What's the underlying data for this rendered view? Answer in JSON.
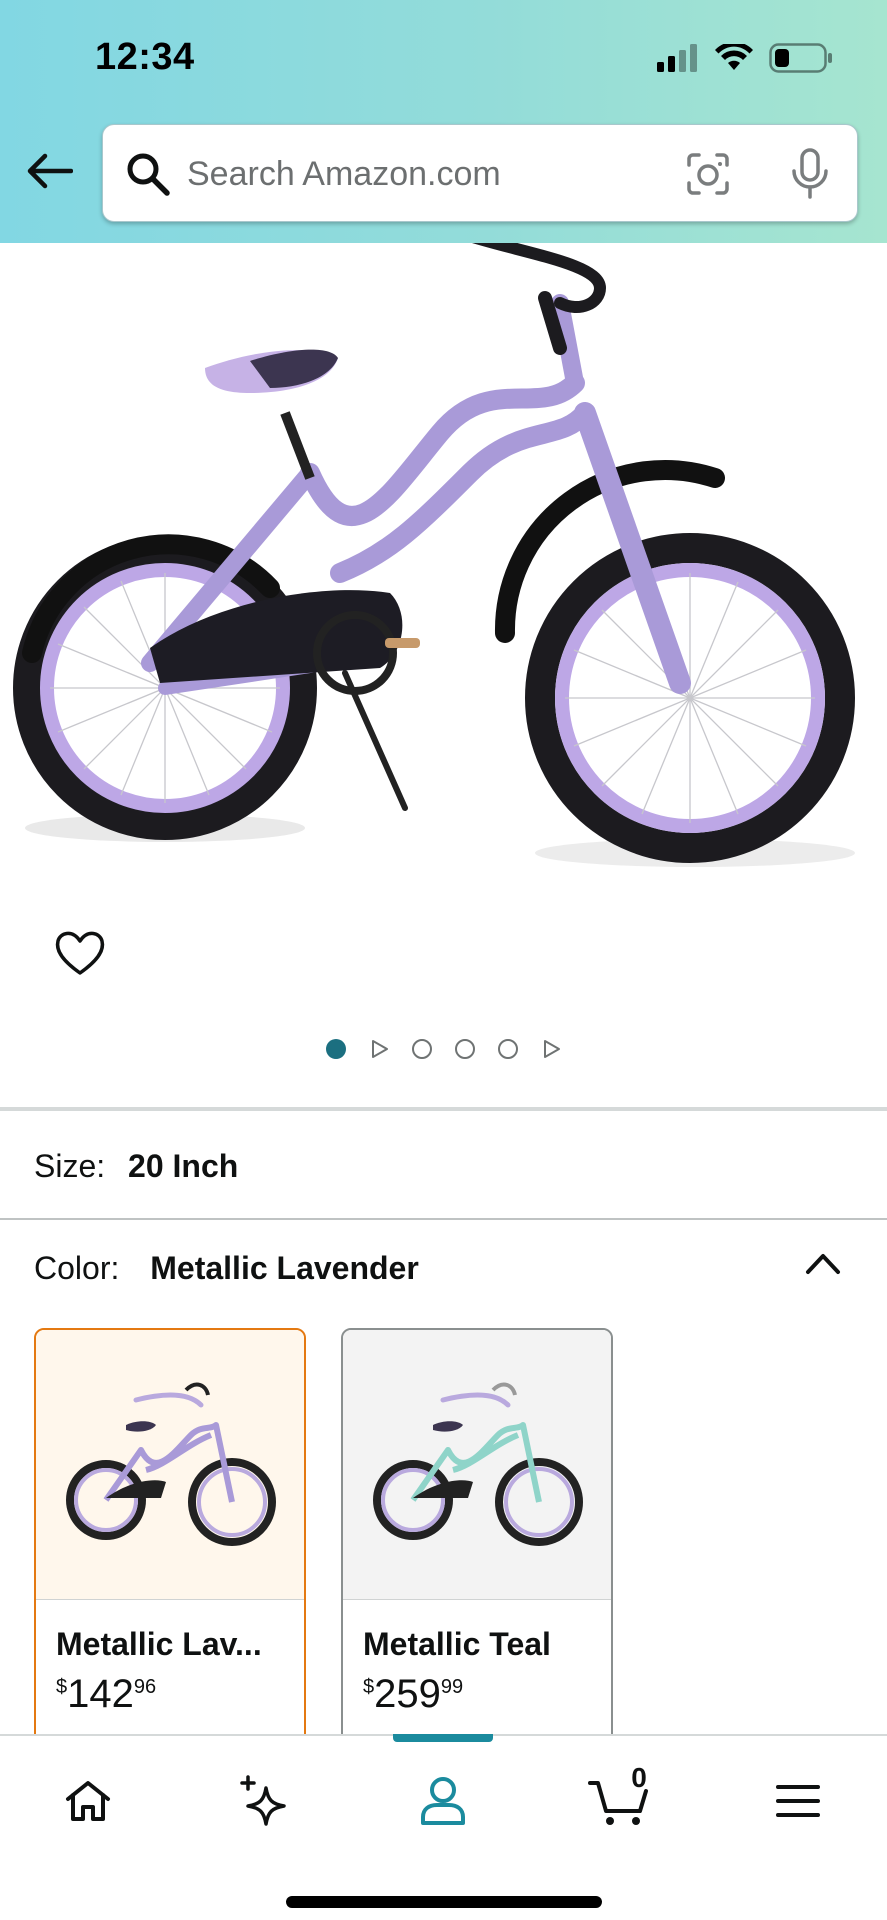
{
  "status_bar": {
    "time": "12:34",
    "icons": [
      "signal-icon",
      "wifi-icon",
      "battery-icon"
    ]
  },
  "search": {
    "placeholder": "Search Amazon.com"
  },
  "product": {
    "image_description": "hero bike image",
    "carousel": {
      "active_index": 0,
      "items": [
        "image",
        "video",
        "image",
        "image",
        "image",
        "video"
      ]
    }
  },
  "size": {
    "label": "Size:",
    "value": "20 Inch"
  },
  "color": {
    "label": "Color:",
    "value": "Metallic Lavender",
    "options": [
      {
        "name": "Metallic Lav...",
        "price_symbol": "$",
        "price_whole": "142",
        "price_fraction": "96",
        "selected": true
      },
      {
        "name": "Metallic Teal",
        "price_symbol": "$",
        "price_whole": "259",
        "price_fraction": "99",
        "selected": false
      }
    ]
  },
  "bottom_nav": {
    "items": [
      "home-icon",
      "rufus-sparkle-icon",
      "account-icon",
      "cart-icon",
      "menu-icon"
    ],
    "active": "account-icon",
    "cart_count": "0"
  },
  "colors": {
    "header_gradient_start": "#82d7e3",
    "header_gradient_end": "#a6e5d0",
    "accent_teal": "#1b8b9e",
    "selected_border": "#e47911",
    "lavender": "#b9a9de"
  }
}
